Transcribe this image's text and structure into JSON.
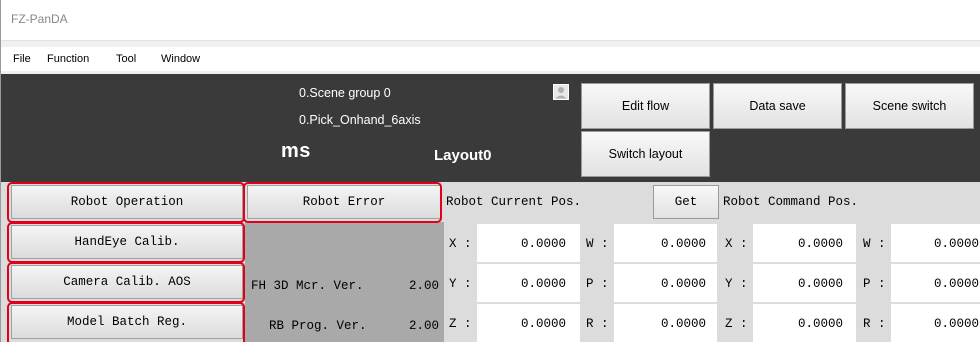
{
  "window": {
    "title": "FZ-PanDA"
  },
  "menu": [
    "File",
    "Function",
    "Tool",
    "Window"
  ],
  "header": {
    "scene_group": "0.Scene group 0",
    "scene": "0.Pick_Onhand_6axis",
    "ms": "ms",
    "layout": "Layout0"
  },
  "toolbar": {
    "edit_flow": "Edit flow",
    "data_save": "Data save",
    "scene_switch": "Scene switch",
    "switch_layout": "Switch layout"
  },
  "left_buttons": [
    "Robot Operation",
    "HandEye Calib.",
    "Camera Calib. AOS",
    "Model Batch Reg."
  ],
  "robot_error": "Robot Error",
  "info": [
    {
      "label": "FH 3D Mcr. Ver.",
      "value": "2.00"
    },
    {
      "label": "RB Prog. Ver.",
      "value": "2.00"
    }
  ],
  "current_pos": {
    "title": "Robot Current Pos.",
    "get": "Get",
    "rows": [
      {
        "a": "X :",
        "av": "0.0000",
        "b": "W :",
        "bv": "0.0000"
      },
      {
        "a": "Y :",
        "av": "0.0000",
        "b": "P :",
        "bv": "0.0000"
      },
      {
        "a": "Z :",
        "av": "0.0000",
        "b": "R :",
        "bv": "0.0000"
      }
    ]
  },
  "command_pos": {
    "title": "Robot Command Pos.",
    "rows": [
      {
        "a": "X :",
        "av": "0.0000",
        "b": "W :",
        "bv": "0.0000"
      },
      {
        "a": "Y :",
        "av": "0.0000",
        "b": "P :",
        "bv": "0.0000"
      },
      {
        "a": "Z :",
        "av": "0.0000",
        "b": "R :",
        "bv": "0.0000"
      }
    ]
  },
  "colors": {
    "highlight": "#e0001a",
    "dark_panel": "#3a3a3a"
  }
}
